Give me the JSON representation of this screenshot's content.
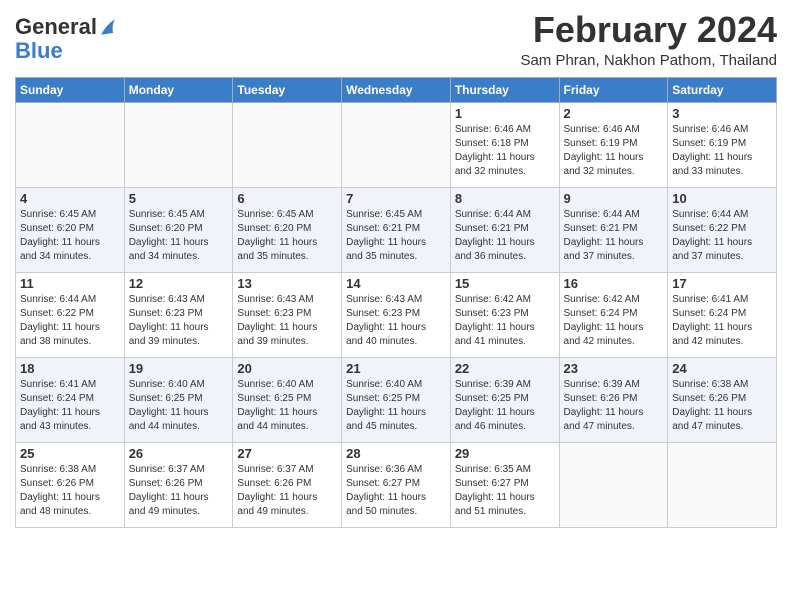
{
  "header": {
    "logo_line1": "General",
    "logo_line2": "Blue",
    "title": "February 2024",
    "subtitle": "Sam Phran, Nakhon Pathom, Thailand"
  },
  "days_of_week": [
    "Sunday",
    "Monday",
    "Tuesday",
    "Wednesday",
    "Thursday",
    "Friday",
    "Saturday"
  ],
  "weeks": [
    [
      {
        "day": "",
        "info": ""
      },
      {
        "day": "",
        "info": ""
      },
      {
        "day": "",
        "info": ""
      },
      {
        "day": "",
        "info": ""
      },
      {
        "day": "1",
        "info": "Sunrise: 6:46 AM\nSunset: 6:18 PM\nDaylight: 11 hours\nand 32 minutes."
      },
      {
        "day": "2",
        "info": "Sunrise: 6:46 AM\nSunset: 6:19 PM\nDaylight: 11 hours\nand 32 minutes."
      },
      {
        "day": "3",
        "info": "Sunrise: 6:46 AM\nSunset: 6:19 PM\nDaylight: 11 hours\nand 33 minutes."
      }
    ],
    [
      {
        "day": "4",
        "info": "Sunrise: 6:45 AM\nSunset: 6:20 PM\nDaylight: 11 hours\nand 34 minutes."
      },
      {
        "day": "5",
        "info": "Sunrise: 6:45 AM\nSunset: 6:20 PM\nDaylight: 11 hours\nand 34 minutes."
      },
      {
        "day": "6",
        "info": "Sunrise: 6:45 AM\nSunset: 6:20 PM\nDaylight: 11 hours\nand 35 minutes."
      },
      {
        "day": "7",
        "info": "Sunrise: 6:45 AM\nSunset: 6:21 PM\nDaylight: 11 hours\nand 35 minutes."
      },
      {
        "day": "8",
        "info": "Sunrise: 6:44 AM\nSunset: 6:21 PM\nDaylight: 11 hours\nand 36 minutes."
      },
      {
        "day": "9",
        "info": "Sunrise: 6:44 AM\nSunset: 6:21 PM\nDaylight: 11 hours\nand 37 minutes."
      },
      {
        "day": "10",
        "info": "Sunrise: 6:44 AM\nSunset: 6:22 PM\nDaylight: 11 hours\nand 37 minutes."
      }
    ],
    [
      {
        "day": "11",
        "info": "Sunrise: 6:44 AM\nSunset: 6:22 PM\nDaylight: 11 hours\nand 38 minutes."
      },
      {
        "day": "12",
        "info": "Sunrise: 6:43 AM\nSunset: 6:23 PM\nDaylight: 11 hours\nand 39 minutes."
      },
      {
        "day": "13",
        "info": "Sunrise: 6:43 AM\nSunset: 6:23 PM\nDaylight: 11 hours\nand 39 minutes."
      },
      {
        "day": "14",
        "info": "Sunrise: 6:43 AM\nSunset: 6:23 PM\nDaylight: 11 hours\nand 40 minutes."
      },
      {
        "day": "15",
        "info": "Sunrise: 6:42 AM\nSunset: 6:23 PM\nDaylight: 11 hours\nand 41 minutes."
      },
      {
        "day": "16",
        "info": "Sunrise: 6:42 AM\nSunset: 6:24 PM\nDaylight: 11 hours\nand 42 minutes."
      },
      {
        "day": "17",
        "info": "Sunrise: 6:41 AM\nSunset: 6:24 PM\nDaylight: 11 hours\nand 42 minutes."
      }
    ],
    [
      {
        "day": "18",
        "info": "Sunrise: 6:41 AM\nSunset: 6:24 PM\nDaylight: 11 hours\nand 43 minutes."
      },
      {
        "day": "19",
        "info": "Sunrise: 6:40 AM\nSunset: 6:25 PM\nDaylight: 11 hours\nand 44 minutes."
      },
      {
        "day": "20",
        "info": "Sunrise: 6:40 AM\nSunset: 6:25 PM\nDaylight: 11 hours\nand 44 minutes."
      },
      {
        "day": "21",
        "info": "Sunrise: 6:40 AM\nSunset: 6:25 PM\nDaylight: 11 hours\nand 45 minutes."
      },
      {
        "day": "22",
        "info": "Sunrise: 6:39 AM\nSunset: 6:25 PM\nDaylight: 11 hours\nand 46 minutes."
      },
      {
        "day": "23",
        "info": "Sunrise: 6:39 AM\nSunset: 6:26 PM\nDaylight: 11 hours\nand 47 minutes."
      },
      {
        "day": "24",
        "info": "Sunrise: 6:38 AM\nSunset: 6:26 PM\nDaylight: 11 hours\nand 47 minutes."
      }
    ],
    [
      {
        "day": "25",
        "info": "Sunrise: 6:38 AM\nSunset: 6:26 PM\nDaylight: 11 hours\nand 48 minutes."
      },
      {
        "day": "26",
        "info": "Sunrise: 6:37 AM\nSunset: 6:26 PM\nDaylight: 11 hours\nand 49 minutes."
      },
      {
        "day": "27",
        "info": "Sunrise: 6:37 AM\nSunset: 6:26 PM\nDaylight: 11 hours\nand 49 minutes."
      },
      {
        "day": "28",
        "info": "Sunrise: 6:36 AM\nSunset: 6:27 PM\nDaylight: 11 hours\nand 50 minutes."
      },
      {
        "day": "29",
        "info": "Sunrise: 6:35 AM\nSunset: 6:27 PM\nDaylight: 11 hours\nand 51 minutes."
      },
      {
        "day": "",
        "info": ""
      },
      {
        "day": "",
        "info": ""
      }
    ]
  ]
}
